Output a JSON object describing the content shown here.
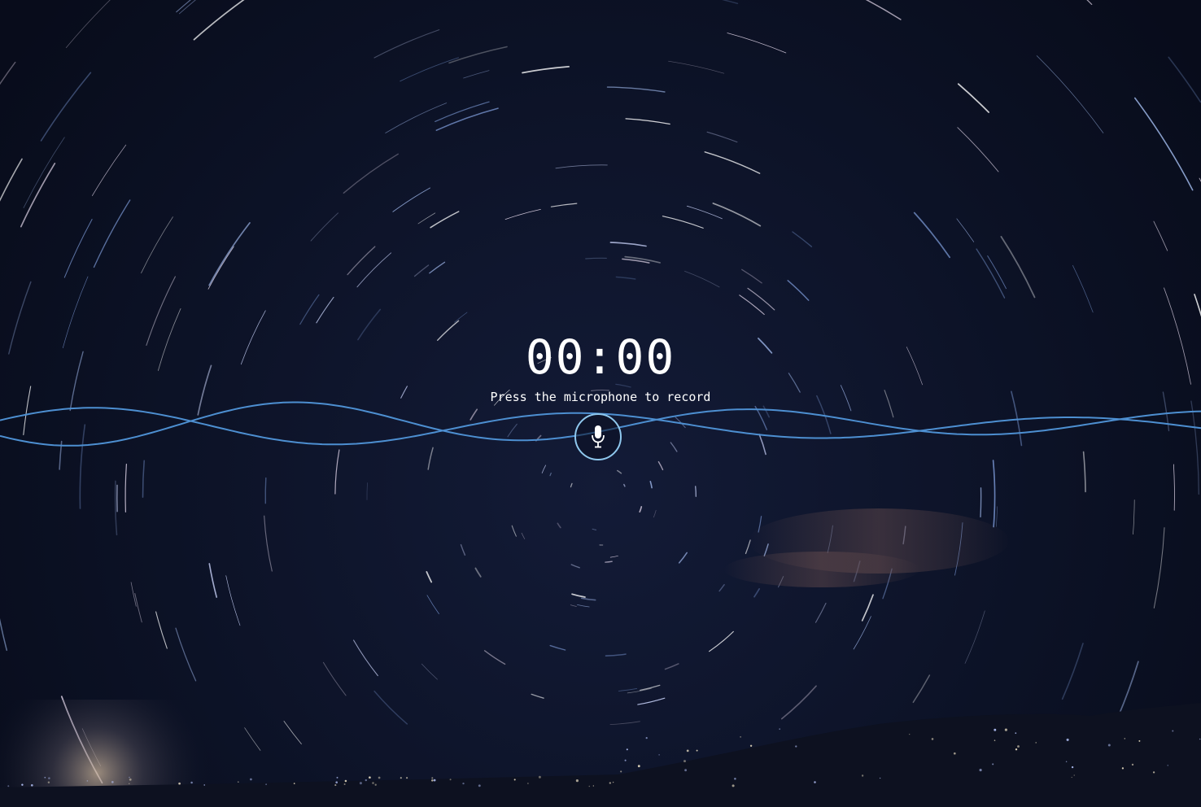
{
  "recorder": {
    "timer": "00:00",
    "hint": "Press the microphone to record"
  },
  "icons": {
    "record": "microphone-icon"
  },
  "colors": {
    "background": "#0b1022",
    "waveform": "#4d8fd1",
    "mic_ring": "#8fc8ee",
    "text": "#ffffff"
  }
}
